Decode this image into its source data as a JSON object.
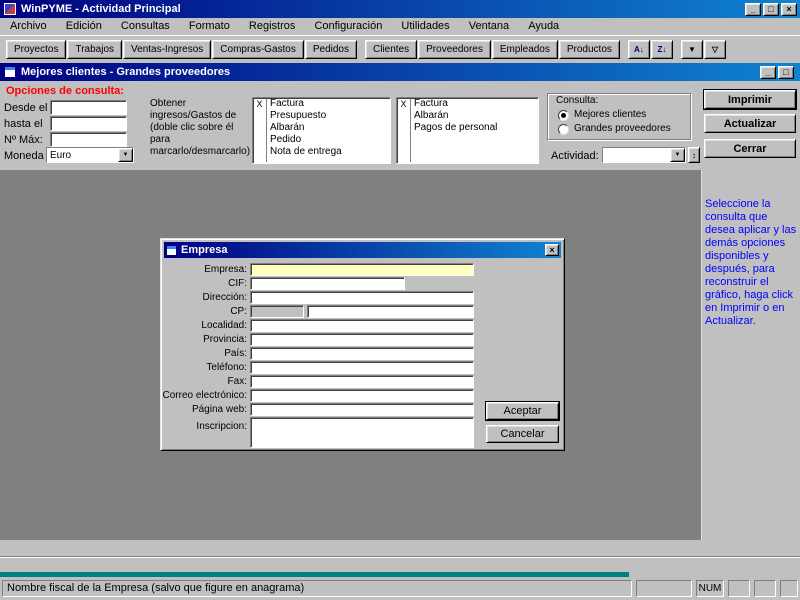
{
  "window": {
    "title": "WinPYME - Actividad Principal"
  },
  "menubar": {
    "items": [
      "Archivo",
      "Edición",
      "Consultas",
      "Formato",
      "Registros",
      "Configuración",
      "Utilidades",
      "Ventana",
      "Ayuda"
    ]
  },
  "toolbar": {
    "group1": [
      "Proyectos",
      "Trabajos",
      "Ventas-Ingresos",
      "Compras-Gastos",
      "Pedidos"
    ],
    "group2": [
      "Clientes",
      "Proveedores",
      "Empleados",
      "Productos"
    ]
  },
  "child_window": {
    "title": "Mejores clientes - Grandes proveedores"
  },
  "query": {
    "heading": "Opciones de consulta:",
    "desde_label": "Desde el",
    "hasta_label": "hasta el",
    "max_label": "Nº Máx:",
    "moneda_label": "Moneda",
    "desde_value": "",
    "hasta_value": "",
    "max_value": "",
    "moneda_value": "Euro",
    "instruction": "Obtener ingresos/Gastos de (doble clic sobre él para marcarlo/desmarcarlo)",
    "ingresos_items": [
      {
        "mark": "X",
        "label": "Factura"
      },
      {
        "mark": "",
        "label": "Presupuesto"
      },
      {
        "mark": "",
        "label": "Albarán"
      },
      {
        "mark": "",
        "label": "Pedido"
      },
      {
        "mark": "",
        "label": "Nota de entrega"
      }
    ],
    "gastos_items": [
      {
        "mark": "X",
        "label": "Factura"
      },
      {
        "mark": "",
        "label": "Albarán"
      },
      {
        "mark": "",
        "label": "Pagos de personal"
      }
    ],
    "consulta_label": "Consulta:",
    "consulta_options": [
      {
        "label": "Mejores clientes",
        "selected": true
      },
      {
        "label": "Grandes proveedores",
        "selected": false
      }
    ],
    "actividad_label": "Actividad:",
    "actividad_value": ""
  },
  "actions": {
    "imprimir": "Imprimir",
    "actualizar": "Actualizar",
    "cerrar": "Cerrar"
  },
  "help_text": "Seleccione la consulta que desea aplicar y las demás opciones disponibles y después, para reconstruir el gráfico, haga click en Imprimir o en Actualizar.",
  "dialog": {
    "title": "Empresa",
    "fields": {
      "empresa": {
        "label": "Empresa:",
        "value": ""
      },
      "cif": {
        "label": "CIF:",
        "value": ""
      },
      "direccion": {
        "label": "Dirección:",
        "value": ""
      },
      "cp": {
        "label": "CP:",
        "value": "",
        "value2": ""
      },
      "localidad": {
        "label": "Localidad:",
        "value": ""
      },
      "provincia": {
        "label": "Provincia:",
        "value": ""
      },
      "pais": {
        "label": "País:",
        "value": ""
      },
      "telefono": {
        "label": "Teléfono:",
        "value": ""
      },
      "fax": {
        "label": "Fax:",
        "value": ""
      },
      "correo": {
        "label": "Correo electrónico:",
        "value": ""
      },
      "web": {
        "label": "Página web:",
        "value": ""
      },
      "inscripcion": {
        "label": "Inscripcion:",
        "value": ""
      }
    },
    "buttons": {
      "aceptar": "Aceptar",
      "cancelar": "Cancelar"
    }
  },
  "statusbar": {
    "message": "Nombre fiscal de la Empresa (salvo que figure en anagrama)",
    "num": "NUM"
  },
  "icons": {
    "minimize": "_",
    "maximize": "□",
    "close": "×",
    "child_minimize": "_",
    "child_maximize": "□",
    "dropdown": "▼",
    "sort_asc": "A↓",
    "sort_desc": "Z↓",
    "filter": "▼",
    "filter_alt": "▽",
    "spinner": "↕",
    "dialog_close": "×"
  },
  "colors": {
    "titlebar_start": "#000080",
    "titlebar_end": "#1084d0",
    "chrome": "#c0c0c0",
    "workspace": "#808080",
    "field_yellow": "#ffffbe",
    "heading_red": "#ff0000",
    "help_blue": "#0000ff",
    "accent_teal": "#008080"
  }
}
